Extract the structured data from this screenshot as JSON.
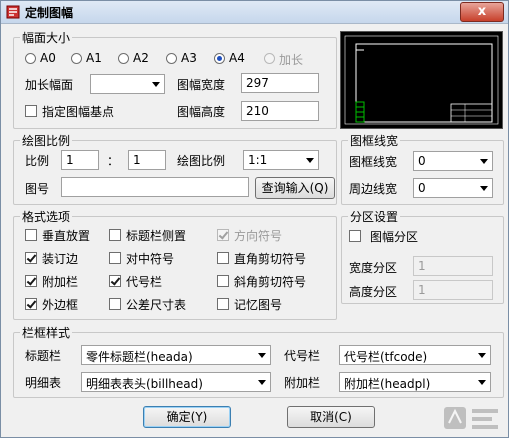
{
  "window": {
    "title": "定制图幅",
    "close_label": "x"
  },
  "size_group": {
    "legend": "幅面大小",
    "options": [
      {
        "label": "A0",
        "selected": false,
        "enabled": true
      },
      {
        "label": "A1",
        "selected": false,
        "enabled": true
      },
      {
        "label": "A2",
        "selected": false,
        "enabled": true
      },
      {
        "label": "A3",
        "selected": false,
        "enabled": true
      },
      {
        "label": "A4",
        "selected": true,
        "enabled": true
      },
      {
        "label": "加长",
        "selected": false,
        "enabled": false
      }
    ],
    "extended_label": "加长幅面",
    "extended_value": "",
    "width_label": "图幅宽度",
    "width_value": "297",
    "height_label": "图幅高度",
    "height_value": "210",
    "basepoint_label": "指定图幅基点",
    "basepoint_checked": false
  },
  "scale_group": {
    "legend": "绘图比例",
    "ratio_label": "比例",
    "ratio_left": "1",
    "colon": "：",
    "ratio_right": "1",
    "drawing_scale_label": "绘图比例",
    "drawing_scale_value": "1:1",
    "drawing_no_label": "图号",
    "drawing_no_value": "",
    "query_button": "查询输入(Q)"
  },
  "frame_width_group": {
    "legend": "图框线宽",
    "frame_label": "图框线宽",
    "frame_value": "0",
    "border_label": "周边线宽",
    "border_value": "0"
  },
  "format_group": {
    "legend": "格式选项",
    "options": [
      {
        "label": "垂直放置",
        "checked": false,
        "enabled": true
      },
      {
        "label": "标题栏侧置",
        "checked": false,
        "enabled": true
      },
      {
        "label": "方向符号",
        "checked": true,
        "enabled": false
      },
      {
        "label": "装订边",
        "checked": true,
        "enabled": true
      },
      {
        "label": "对中符号",
        "checked": false,
        "enabled": true
      },
      {
        "label": "直角剪切符号",
        "checked": false,
        "enabled": true
      },
      {
        "label": "附加栏",
        "checked": true,
        "enabled": true
      },
      {
        "label": "代号栏",
        "checked": true,
        "enabled": true
      },
      {
        "label": "斜角剪切符号",
        "checked": false,
        "enabled": true
      },
      {
        "label": "外边框",
        "checked": true,
        "enabled": true
      },
      {
        "label": "公差尺寸表",
        "checked": false,
        "enabled": true
      },
      {
        "label": "记忆图号",
        "checked": false,
        "enabled": true
      }
    ]
  },
  "zone_group": {
    "legend": "分区设置",
    "zone_label": "图幅分区",
    "zone_checked": false,
    "width_label": "宽度分区",
    "width_value": "1",
    "height_label": "高度分区",
    "height_value": "1"
  },
  "style_group": {
    "legend": "栏框样式",
    "title_label": "标题栏",
    "title_value": "零件标题栏(heada)",
    "code_label": "代号栏",
    "code_value": "代号栏(tfcode)",
    "detail_label": "明细表",
    "detail_value": "明细表表头(billhead)",
    "extra_label": "附加栏",
    "extra_value": "附加栏(headpl)"
  },
  "buttons": {
    "ok": "确定(Y)",
    "cancel": "取消(C)"
  },
  "colors": {
    "preview_bg": "#000000",
    "preview_frame": "#ffffff",
    "preview_margin": "#00c000"
  },
  "watermark_icon": "logo-icon"
}
